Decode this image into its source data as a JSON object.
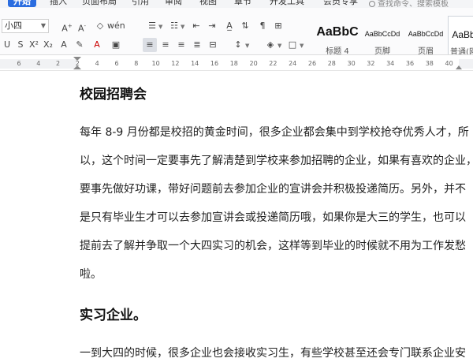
{
  "tabs": [
    "开始",
    "插入",
    "页面布局",
    "引用",
    "审阅",
    "视图",
    "章节",
    "开发工具",
    "会员专享"
  ],
  "search": {
    "placeholder": "查找命令、搜索模板"
  },
  "ribbon": {
    "font_size": "小四",
    "styles": [
      {
        "sample": "AaBbC",
        "name": "标题 4"
      },
      {
        "sample": "AaBbCcDd",
        "name": "页脚"
      },
      {
        "sample": "AaBbCcDd",
        "name": "页眉"
      },
      {
        "sample": "AaBb",
        "name": "普通(网"
      }
    ]
  },
  "ruler": {
    "ticks": [
      "6",
      "4",
      "2",
      "2",
      "4",
      "6",
      "8",
      "10",
      "12",
      "14",
      "16",
      "18",
      "20",
      "22",
      "24",
      "26",
      "28",
      "30",
      "32",
      "34",
      "36",
      "38",
      "40"
    ]
  },
  "document": {
    "heading1": "校园招聘会",
    "para1": [
      "每年 8-9 月份都是校招的黄金时间，很多企业都会集中到学校抢夺优秀人才，所",
      "以，这个时间一定要事先了解清楚到学校来参加招聘的企业，如果有喜欢的企业，",
      "要事先做好功课，带好问题前去参加企业的宣讲会并积极投递简历。另外，并不",
      "是只有毕业生才可以去参加宣讲会或投递简历哦，如果你是大三的学生，也可以",
      "提前去了解并争取一个大四实习的机会，这样等到毕业的时候就不用为工作发愁",
      "啦。"
    ],
    "heading2": "实习企业。",
    "para2": [
      "一到大四的时候，很多企业也会接收实习生，有些学校甚至还会专门联系企业安"
    ]
  }
}
